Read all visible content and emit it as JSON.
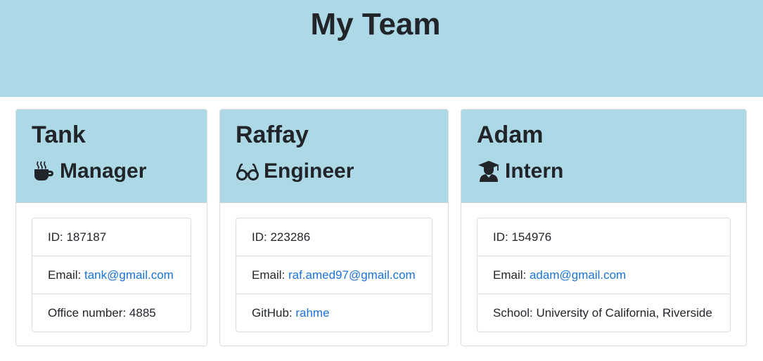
{
  "header": {
    "title": "My Team"
  },
  "members": [
    {
      "name": "Tank",
      "role": "Manager",
      "icon": "coffee-icon",
      "id_label": "ID: ",
      "id": "187187",
      "email_label": "Email: ",
      "email": "tank@gmail.com",
      "extra_label": "Office number: ",
      "extra": "4885"
    },
    {
      "name": "Raffay",
      "role": "Engineer",
      "icon": "glasses-icon",
      "id_label": "ID: ",
      "id": "223286",
      "email_label": "Email: ",
      "email": "raf.amed97@gmail.com",
      "extra_label": "GitHub: ",
      "extra": "rahme"
    },
    {
      "name": "Adam",
      "role": "Intern",
      "icon": "graduate-icon",
      "id_label": "ID: ",
      "id": "154976",
      "email_label": "Email: ",
      "email": "adam@gmail.com",
      "extra_label": "School: ",
      "extra": "University of California, Riverside"
    }
  ],
  "colors": {
    "header_bg": "#add8e6",
    "link": "#1a73d9",
    "text": "#212529"
  }
}
